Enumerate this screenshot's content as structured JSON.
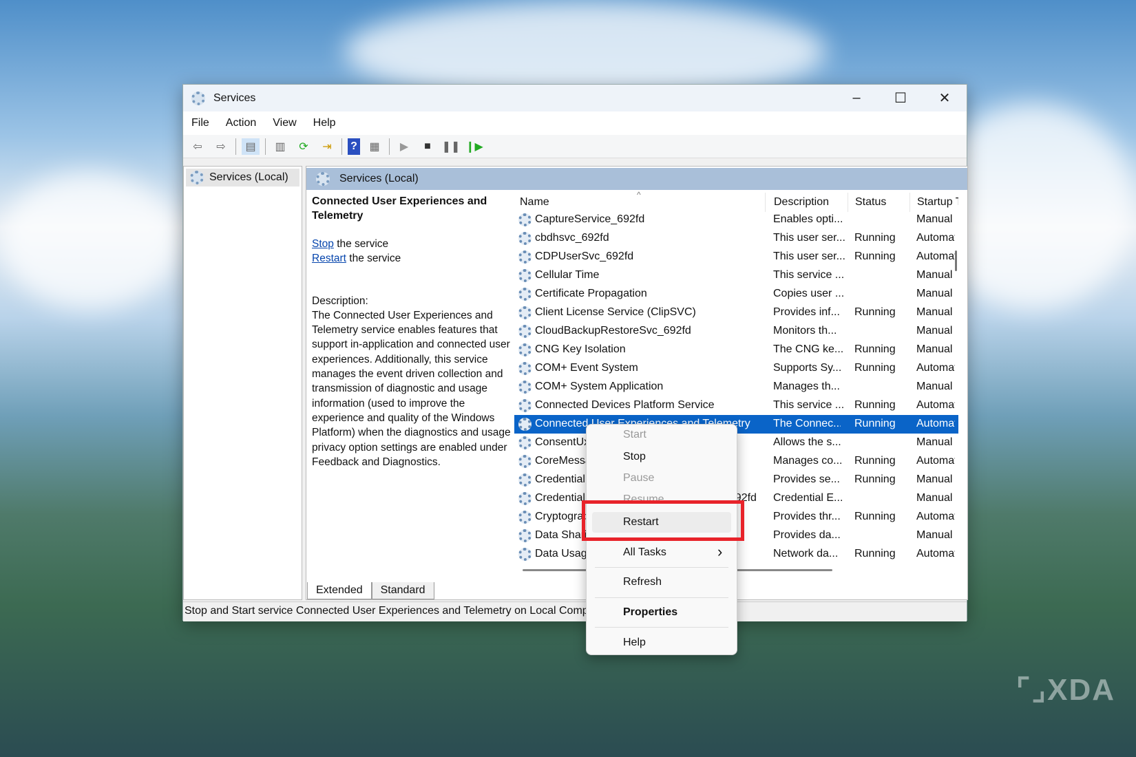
{
  "window": {
    "title": "Services",
    "minimize": "–",
    "maximize": "☐",
    "close": "✕"
  },
  "menu": [
    "File",
    "Action",
    "View",
    "Help"
  ],
  "toolbar": [
    "back-icon",
    "forward-icon",
    "show-hide-console-tree-icon",
    "properties-icon",
    "refresh-icon",
    "export-list-icon",
    "help-icon",
    "show-hide-action-pane-icon",
    "start-service-icon",
    "stop-service-icon",
    "pause-service-icon",
    "resume-service-icon"
  ],
  "tree": {
    "root": "Services (Local)"
  },
  "pane_header": "Services (Local)",
  "details": {
    "title": "Connected User Experiences and Telemetry",
    "stop_link": "Stop",
    "stop_suffix": " the service",
    "restart_link": "Restart",
    "restart_suffix": " the service",
    "desc_label": "Description:",
    "desc_text": "The Connected User Experiences and Telemetry service enables features that support in-application and connected user experiences. Additionally, this service manages the event driven collection and transmission of diagnostic and usage information (used to improve the experience and quality of the Windows Platform) when the diagnostics and usage privacy option settings are enabled under Feedback and Diagnostics."
  },
  "columns": {
    "name": "Name",
    "description": "Description",
    "status": "Status",
    "startup": "Startup Type"
  },
  "rows": [
    {
      "name": "CaptureService_692fd",
      "description": "Enables opti...",
      "status": "",
      "startup": "Manual"
    },
    {
      "name": "cbdhsvc_692fd",
      "description": "This user ser...",
      "status": "Running",
      "startup": "Automatic"
    },
    {
      "name": "CDPUserSvc_692fd",
      "description": "This user ser...",
      "status": "Running",
      "startup": "Automatic"
    },
    {
      "name": "Cellular Time",
      "description": "This service ...",
      "status": "",
      "startup": "Manual"
    },
    {
      "name": "Certificate Propagation",
      "description": "Copies user ...",
      "status": "",
      "startup": "Manual"
    },
    {
      "name": "Client License Service (ClipSVC)",
      "description": "Provides inf...",
      "status": "Running",
      "startup": "Manual"
    },
    {
      "name": "CloudBackupRestoreSvc_692fd",
      "description": "Monitors th...",
      "status": "",
      "startup": "Manual"
    },
    {
      "name": "CNG Key Isolation",
      "description": "The CNG ke...",
      "status": "Running",
      "startup": "Manual"
    },
    {
      "name": "COM+ Event System",
      "description": "Supports Sy...",
      "status": "Running",
      "startup": "Automatic"
    },
    {
      "name": "COM+ System Application",
      "description": "Manages th...",
      "status": "",
      "startup": "Manual"
    },
    {
      "name": "Connected Devices Platform Service",
      "description": "This service ...",
      "status": "Running",
      "startup": "Automatic"
    },
    {
      "name": "Connected User Experiences and Telemetry",
      "description": "The Connec...",
      "status": "Running",
      "startup": "Automatic"
    },
    {
      "name": "ConsentUxUserSvc_692fd",
      "description": "Allows the s...",
      "status": "",
      "startup": "Manual"
    },
    {
      "name": "CoreMessaging",
      "description": "Manages co...",
      "status": "Running",
      "startup": "Automatic"
    },
    {
      "name": "Credential Manager",
      "description": "Provides se...",
      "status": "Running",
      "startup": "Manual"
    },
    {
      "name": "CredentialEnrollmentManagerUserSvc_692fd",
      "description": "Credential E...",
      "status": "",
      "startup": "Manual"
    },
    {
      "name": "Cryptographic Services",
      "description": "Provides thr...",
      "status": "Running",
      "startup": "Automatic"
    },
    {
      "name": "Data Sharing Service",
      "description": "Provides da...",
      "status": "",
      "startup": "Manual"
    },
    {
      "name": "Data Usage",
      "description": "Network da...",
      "status": "Running",
      "startup": "Automatic"
    }
  ],
  "tabs": [
    "Extended",
    "Standard"
  ],
  "statusbar": "Stop and Start service Connected User Experiences and Telemetry on Local Computer",
  "context_menu": {
    "start": "Start",
    "stop": "Stop",
    "pause": "Pause",
    "resume": "Resume",
    "restart": "Restart",
    "all_tasks": "All Tasks",
    "refresh": "Refresh",
    "properties": "Properties",
    "help": "Help",
    "arrow": "›"
  },
  "watermark": "XDA",
  "colors": {
    "selection": "#0a64c8",
    "highlight_box": "#e8232a"
  }
}
